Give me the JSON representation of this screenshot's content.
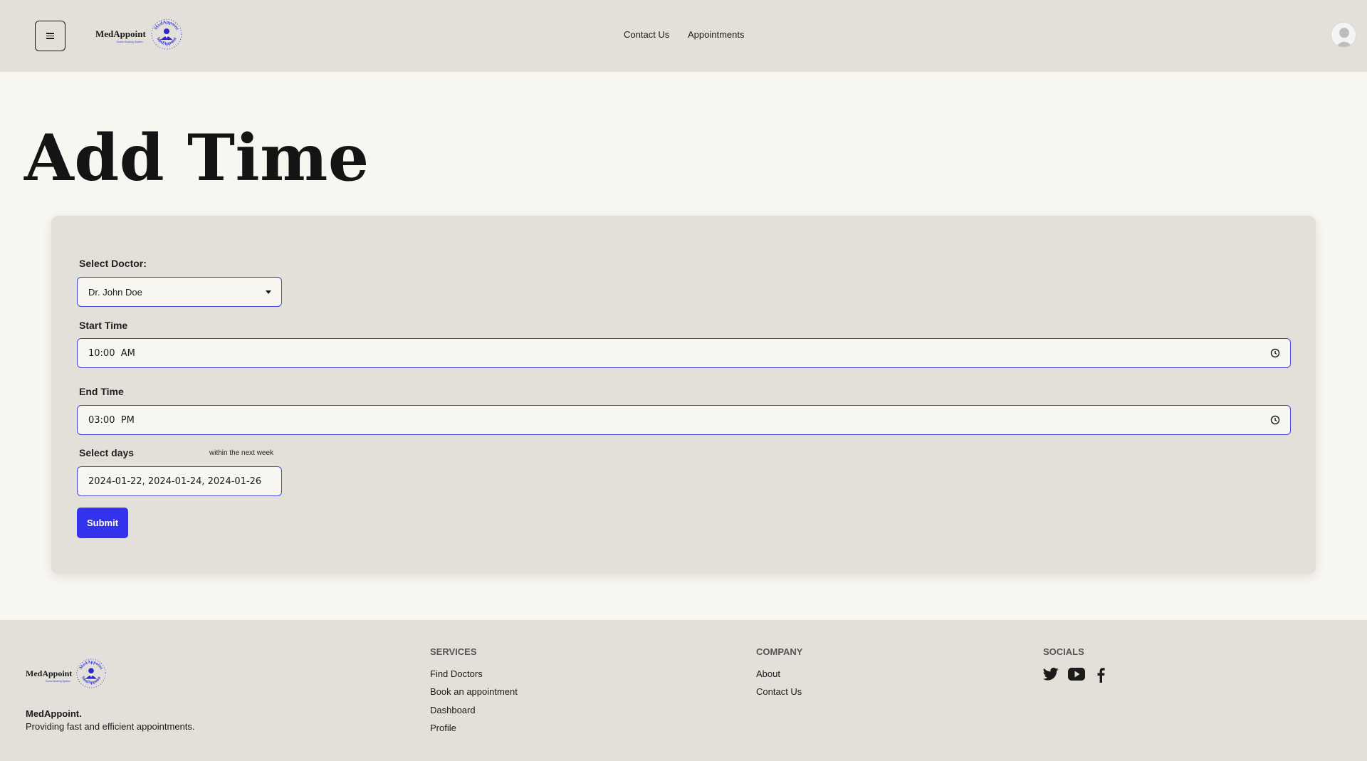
{
  "header": {
    "logo_text": "MedAppoint",
    "logo_tagline": "Doctor Booking System",
    "nav": {
      "contact": "Contact Us",
      "appointments": "Appointments"
    }
  },
  "page": {
    "title": "Add Time"
  },
  "form": {
    "doctor_label": "Select Doctor:",
    "doctor_value": "Dr. John Doe",
    "start_label": "Start Time",
    "start_value": "10:00  AM",
    "end_label": "End Time",
    "end_value": "03:00  PM",
    "days_label": "Select days",
    "days_note": "within the next week",
    "days_value": "2024-01-22, 2024-01-24, 2024-01-26",
    "submit_label": "Submit"
  },
  "footer": {
    "logo_text": "MedAppoint",
    "logo_tagline": "Doctor Booking System",
    "brand_name": "MedAppoint.",
    "brand_tagline": "Providing fast and efficient appointments.",
    "services": {
      "heading": "SERVICES",
      "links": [
        "Find Doctors",
        "Book an appointment",
        "Dashboard",
        "Profile"
      ]
    },
    "company": {
      "heading": "COMPANY",
      "links": [
        "About",
        "Contact Us"
      ]
    },
    "socials": {
      "heading": "SOCIALS",
      "icons": [
        "twitter-icon",
        "youtube-icon",
        "facebook-icon"
      ]
    }
  },
  "colors": {
    "header_bg": "#e3e0da",
    "page_bg": "#f8f6f0",
    "accent": "#3333ee",
    "field_border": "#4646e0"
  }
}
